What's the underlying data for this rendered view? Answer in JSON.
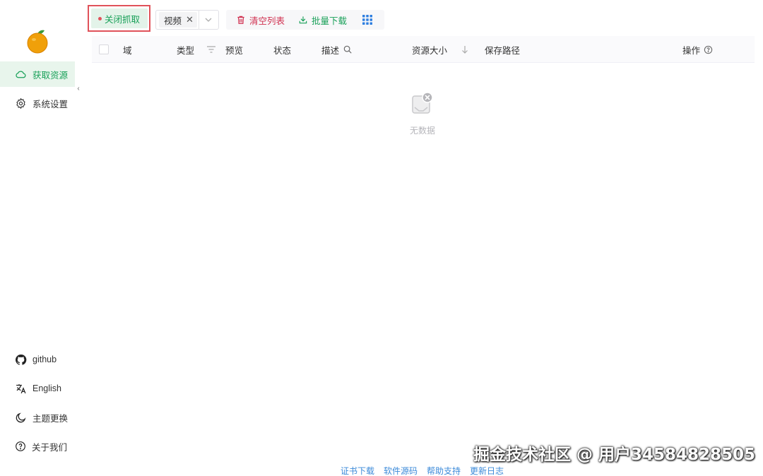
{
  "window": {
    "controls": [
      "close",
      "minimize",
      "maximize"
    ]
  },
  "sidebar": {
    "logo": "orange-logo",
    "items": [
      {
        "label": "获取资源",
        "icon": "cloud-icon",
        "active": true
      },
      {
        "label": "系统设置",
        "icon": "gear-icon",
        "active": false
      }
    ],
    "bottom_items": [
      {
        "label": "github",
        "icon": "github-icon"
      },
      {
        "label": "English",
        "icon": "translate-icon"
      },
      {
        "label": "主题更换",
        "icon": "moon-icon"
      },
      {
        "label": "关于我们",
        "icon": "help-circle-icon"
      }
    ],
    "collapse_glyph": "‹"
  },
  "toolbar": {
    "capture_label": "关闭抓取",
    "filter_selected": "视频",
    "clear_label": "清空列表",
    "batch_download_label": "批量下载"
  },
  "table": {
    "columns": [
      "域",
      "类型",
      "预览",
      "状态",
      "描述",
      "资源大小",
      "保存路径",
      "操作"
    ],
    "empty_text": "无数据"
  },
  "footer": {
    "links": [
      "证书下载",
      "软件源码",
      "帮助支持",
      "更新日志"
    ]
  },
  "watermark": "掘金技术社区 @ 用户34584828505",
  "colors": {
    "accent_green": "#18a058",
    "danger_red": "#d03050",
    "link_blue": "#3b8ad9",
    "highlight_border": "#e0525a"
  }
}
